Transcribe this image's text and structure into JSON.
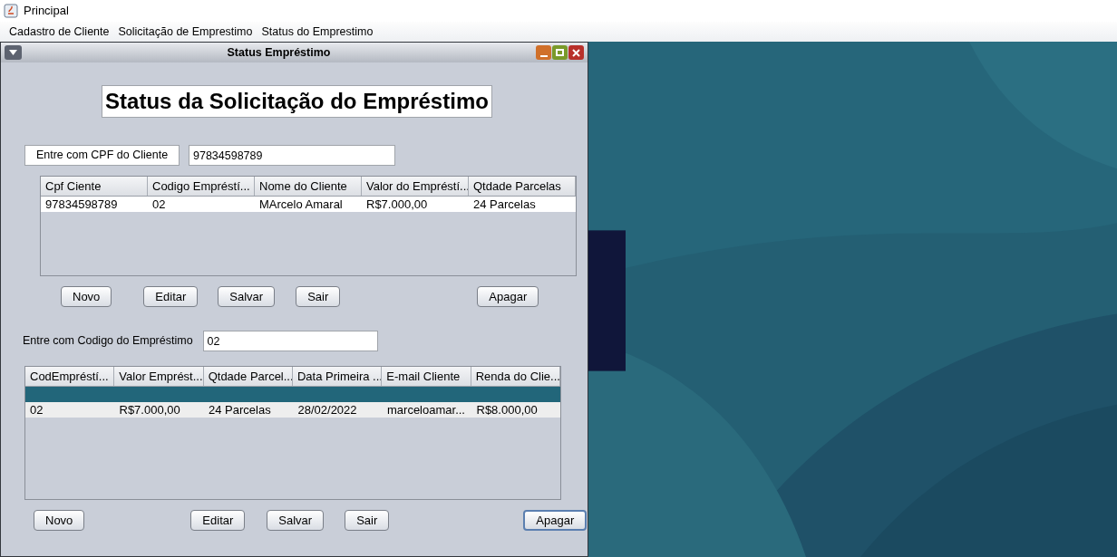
{
  "window": {
    "title": "Principal"
  },
  "menu": [
    "Cadastro de Cliente",
    "Solicitação de Emprestimo",
    "Status do Emprestimo"
  ],
  "frame": {
    "title": "Status Empréstimo"
  },
  "heading": "Status da Solicitação do Empréstimo",
  "cpf": {
    "label": "Entre com CPF do Cliente",
    "value": "97834598789"
  },
  "table1": {
    "columns": [
      "Cpf Ciente",
      "Codigo Empréstí...",
      "Nome do Cliente",
      "Valor do Empréstí...",
      "Qtdade Parcelas"
    ],
    "rows": [
      {
        "selected": false,
        "cells": [
          "97834598789",
          "02",
          "MArcelo Amaral",
          "R$7.000,00",
          "24 Parcelas"
        ]
      }
    ]
  },
  "buttons1": [
    {
      "label": "Novo",
      "focused": false
    },
    {
      "label": "Editar",
      "focused": false
    },
    {
      "label": "Salvar",
      "focused": false
    },
    {
      "label": "Sair",
      "focused": false
    },
    {
      "label": "Apagar",
      "focused": false
    }
  ],
  "codigo": {
    "label": "Entre com Codigo do Empréstimo",
    "value": "02"
  },
  "table2": {
    "columns": [
      "CodEmpréstí...",
      "Valor Emprést...",
      "Qtdade Parcel...",
      "Data Primeira ...",
      "E-mail Cliente",
      "Renda do Clie..."
    ],
    "rows": [
      {
        "selected": true,
        "cells": []
      },
      {
        "selected": false,
        "cells": [
          "02",
          "R$7.000,00",
          "24 Parcelas",
          "28/02/2022",
          "marceloamar...",
          "R$8.000,00"
        ]
      }
    ]
  },
  "buttons2": [
    {
      "label": "Novo",
      "focused": false
    },
    {
      "label": "Editar",
      "focused": false
    },
    {
      "label": "Salvar",
      "focused": false
    },
    {
      "label": "Sair",
      "focused": false
    },
    {
      "label": "Apagar",
      "focused": true
    }
  ]
}
